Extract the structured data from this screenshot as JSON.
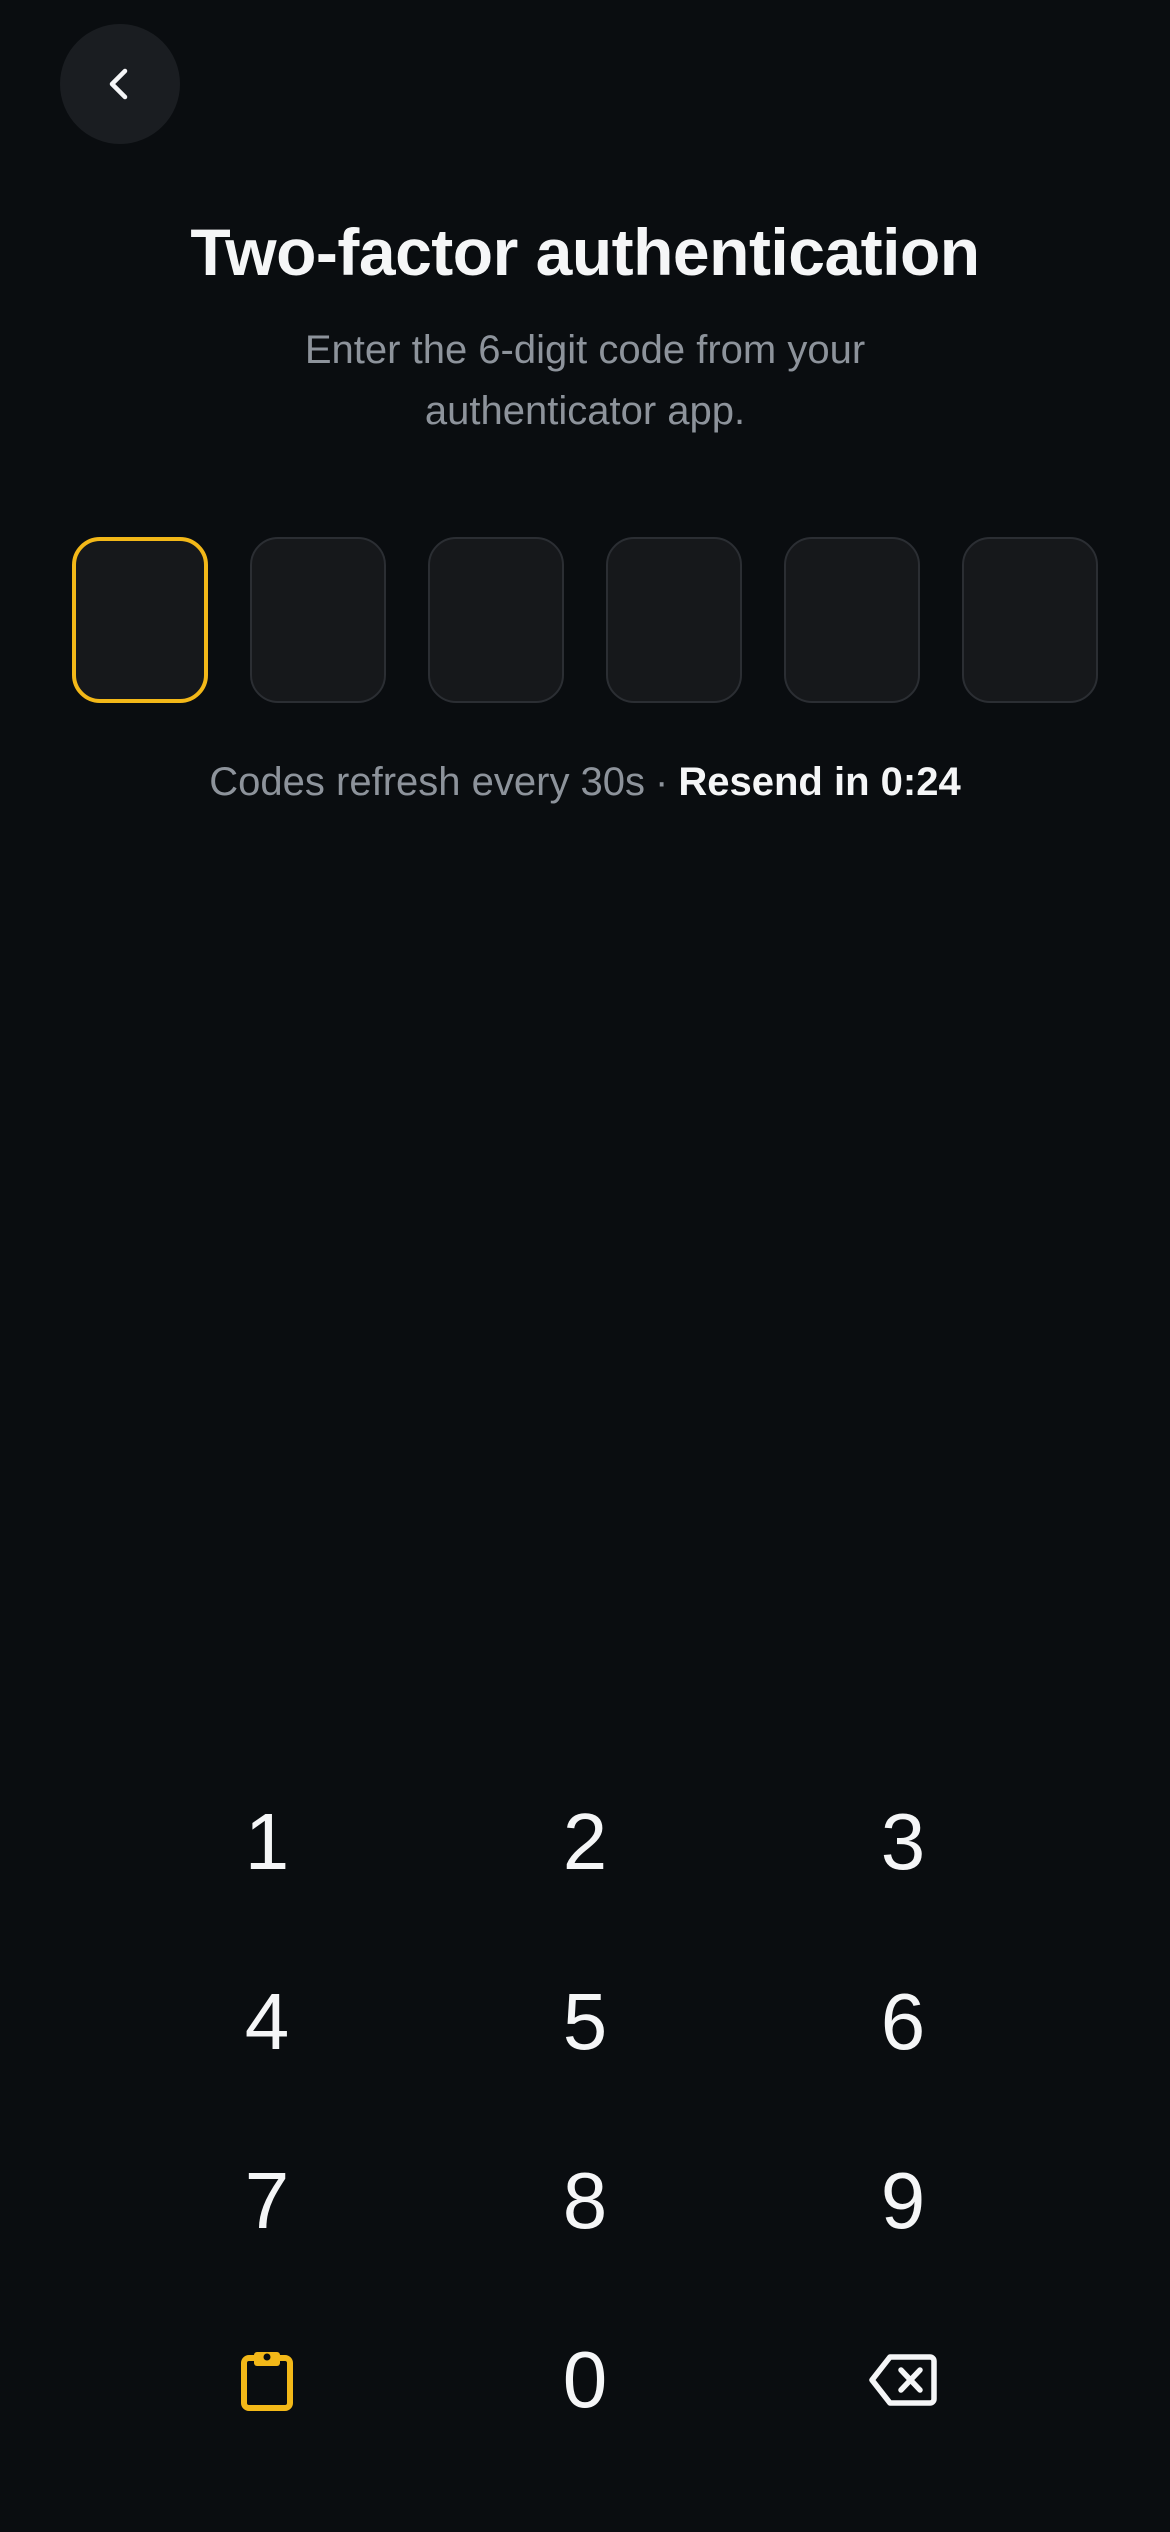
{
  "header": {
    "back_icon": "chevron-left-icon"
  },
  "page": {
    "title": "Two-factor authentication",
    "subtitle": "Enter the 6-digit code from your authenticator app."
  },
  "code_input": {
    "length": 6,
    "active_index": 0,
    "digits": [
      "",
      "",
      "",
      "",
      "",
      ""
    ],
    "accent_color": "#f3b818"
  },
  "info": {
    "text": "Codes refresh every 30s",
    "separator": "·",
    "resend": "Resend in 0:24"
  },
  "keypad": {
    "keys": [
      "1",
      "2",
      "3",
      "4",
      "5",
      "6",
      "7",
      "8",
      "9",
      "0"
    ],
    "paste_icon": "clipboard-icon",
    "delete_icon": "backspace-icon"
  }
}
